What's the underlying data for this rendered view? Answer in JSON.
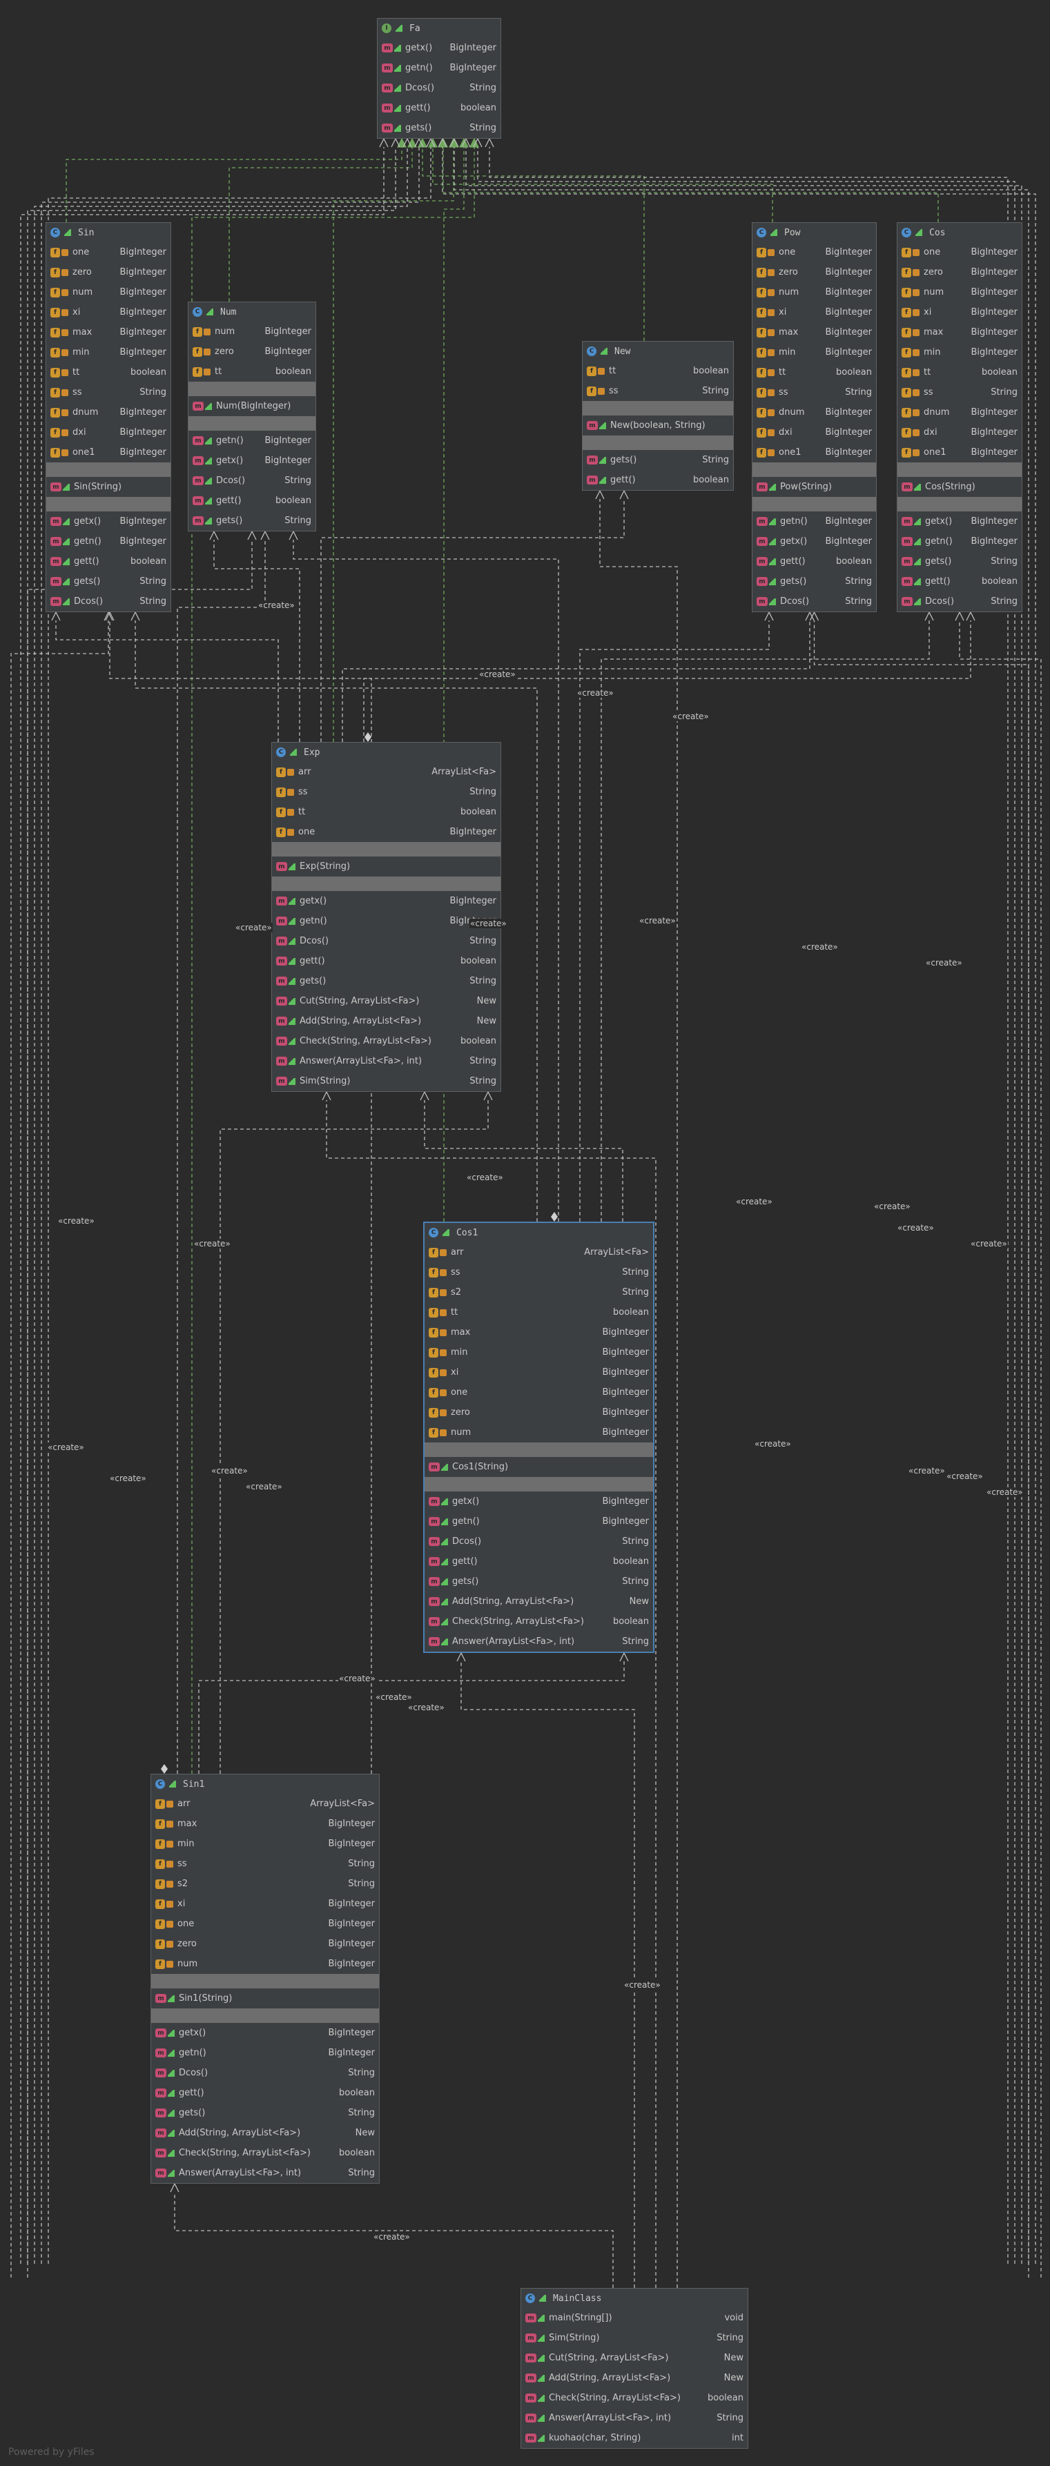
{
  "create_label": "«create»",
  "footer": "Powered by yFiles",
  "classes": {
    "fa": {
      "name": "Fa",
      "methods": [
        {
          "name": "getx()",
          "type": "BigInteger"
        },
        {
          "name": "getn()",
          "type": "BigInteger"
        },
        {
          "name": "Dcos()",
          "type": "String"
        },
        {
          "name": "gett()",
          "type": "boolean"
        },
        {
          "name": "gets()",
          "type": "String"
        }
      ]
    },
    "sin": {
      "name": "Sin",
      "fields": [
        {
          "name": "one",
          "type": "BigInteger"
        },
        {
          "name": "zero",
          "type": "BigInteger"
        },
        {
          "name": "num",
          "type": "BigInteger"
        },
        {
          "name": "xi",
          "type": "BigInteger"
        },
        {
          "name": "max",
          "type": "BigInteger"
        },
        {
          "name": "min",
          "type": "BigInteger"
        },
        {
          "name": "tt",
          "type": "boolean"
        },
        {
          "name": "ss",
          "type": "String"
        },
        {
          "name": "dnum",
          "type": "BigInteger"
        },
        {
          "name": "dxi",
          "type": "BigInteger"
        },
        {
          "name": "one1",
          "type": "BigInteger"
        }
      ],
      "constructors": [
        {
          "name": "Sin(String)",
          "type": ""
        }
      ],
      "methods": [
        {
          "name": "getx()",
          "type": "BigInteger"
        },
        {
          "name": "getn()",
          "type": "BigInteger"
        },
        {
          "name": "gett()",
          "type": "boolean"
        },
        {
          "name": "gets()",
          "type": "String"
        },
        {
          "name": "Dcos()",
          "type": "String"
        }
      ]
    },
    "num": {
      "name": "Num",
      "fields": [
        {
          "name": "num",
          "type": "BigInteger"
        },
        {
          "name": "zero",
          "type": "BigInteger"
        },
        {
          "name": "tt",
          "type": "boolean"
        }
      ],
      "constructors": [
        {
          "name": "Num(BigInteger)",
          "type": ""
        }
      ],
      "methods": [
        {
          "name": "getn()",
          "type": "BigInteger"
        },
        {
          "name": "getx()",
          "type": "BigInteger"
        },
        {
          "name": "Dcos()",
          "type": "String"
        },
        {
          "name": "gett()",
          "type": "boolean"
        },
        {
          "name": "gets()",
          "type": "String"
        }
      ]
    },
    "new": {
      "name": "New",
      "fields": [
        {
          "name": "tt",
          "type": "boolean"
        },
        {
          "name": "ss",
          "type": "String"
        }
      ],
      "constructors": [
        {
          "name": "New(boolean, String)",
          "type": ""
        }
      ],
      "methods": [
        {
          "name": "gets()",
          "type": "String"
        },
        {
          "name": "gett()",
          "type": "boolean"
        }
      ]
    },
    "pow": {
      "name": "Pow",
      "fields": [
        {
          "name": "one",
          "type": "BigInteger"
        },
        {
          "name": "zero",
          "type": "BigInteger"
        },
        {
          "name": "num",
          "type": "BigInteger"
        },
        {
          "name": "xi",
          "type": "BigInteger"
        },
        {
          "name": "max",
          "type": "BigInteger"
        },
        {
          "name": "min",
          "type": "BigInteger"
        },
        {
          "name": "tt",
          "type": "boolean"
        },
        {
          "name": "ss",
          "type": "String"
        },
        {
          "name": "dnum",
          "type": "BigInteger"
        },
        {
          "name": "dxi",
          "type": "BigInteger"
        },
        {
          "name": "one1",
          "type": "BigInteger"
        }
      ],
      "constructors": [
        {
          "name": "Pow(String)",
          "type": ""
        }
      ],
      "methods": [
        {
          "name": "getn()",
          "type": "BigInteger"
        },
        {
          "name": "getx()",
          "type": "BigInteger"
        },
        {
          "name": "gett()",
          "type": "boolean"
        },
        {
          "name": "gets()",
          "type": "String"
        },
        {
          "name": "Dcos()",
          "type": "String"
        }
      ]
    },
    "cos": {
      "name": "Cos",
      "fields": [
        {
          "name": "one",
          "type": "BigInteger"
        },
        {
          "name": "zero",
          "type": "BigInteger"
        },
        {
          "name": "num",
          "type": "BigInteger"
        },
        {
          "name": "xi",
          "type": "BigInteger"
        },
        {
          "name": "max",
          "type": "BigInteger"
        },
        {
          "name": "min",
          "type": "BigInteger"
        },
        {
          "name": "tt",
          "type": "boolean"
        },
        {
          "name": "ss",
          "type": "String"
        },
        {
          "name": "dnum",
          "type": "BigInteger"
        },
        {
          "name": "dxi",
          "type": "BigInteger"
        },
        {
          "name": "one1",
          "type": "BigInteger"
        }
      ],
      "constructors": [
        {
          "name": "Cos(String)",
          "type": ""
        }
      ],
      "methods": [
        {
          "name": "getx()",
          "type": "BigInteger"
        },
        {
          "name": "getn()",
          "type": "BigInteger"
        },
        {
          "name": "gets()",
          "type": "String"
        },
        {
          "name": "gett()",
          "type": "boolean"
        },
        {
          "name": "Dcos()",
          "type": "String"
        }
      ]
    },
    "exp": {
      "name": "Exp",
      "fields": [
        {
          "name": "arr",
          "type": "ArrayList<Fa>"
        },
        {
          "name": "ss",
          "type": "String"
        },
        {
          "name": "tt",
          "type": "boolean"
        },
        {
          "name": "one",
          "type": "BigInteger"
        }
      ],
      "constructors": [
        {
          "name": "Exp(String)",
          "type": ""
        }
      ],
      "methods": [
        {
          "name": "getx()",
          "type": "BigInteger"
        },
        {
          "name": "getn()",
          "type": "BigInteger"
        },
        {
          "name": "Dcos()",
          "type": "String"
        },
        {
          "name": "gett()",
          "type": "boolean"
        },
        {
          "name": "gets()",
          "type": "String"
        },
        {
          "name": "Cut(String, ArrayList<Fa>)",
          "type": "New"
        },
        {
          "name": "Add(String, ArrayList<Fa>)",
          "type": "New"
        },
        {
          "name": "Check(String, ArrayList<Fa>)",
          "type": "boolean"
        },
        {
          "name": "Answer(ArrayList<Fa>, int)",
          "type": "String"
        },
        {
          "name": "Sim(String)",
          "type": "String"
        }
      ]
    },
    "cos1": {
      "name": "Cos1",
      "fields": [
        {
          "name": "arr",
          "type": "ArrayList<Fa>"
        },
        {
          "name": "ss",
          "type": "String"
        },
        {
          "name": "s2",
          "type": "String"
        },
        {
          "name": "tt",
          "type": "boolean"
        },
        {
          "name": "max",
          "type": "BigInteger"
        },
        {
          "name": "min",
          "type": "BigInteger"
        },
        {
          "name": "xi",
          "type": "BigInteger"
        },
        {
          "name": "one",
          "type": "BigInteger"
        },
        {
          "name": "zero",
          "type": "BigInteger"
        },
        {
          "name": "num",
          "type": "BigInteger"
        }
      ],
      "constructors": [
        {
          "name": "Cos1(String)",
          "type": ""
        }
      ],
      "methods": [
        {
          "name": "getx()",
          "type": "BigInteger"
        },
        {
          "name": "getn()",
          "type": "BigInteger"
        },
        {
          "name": "Dcos()",
          "type": "String"
        },
        {
          "name": "gett()",
          "type": "boolean"
        },
        {
          "name": "gets()",
          "type": "String"
        },
        {
          "name": "Add(String, ArrayList<Fa>)",
          "type": "New"
        },
        {
          "name": "Check(String, ArrayList<Fa>)",
          "type": "boolean"
        },
        {
          "name": "Answer(ArrayList<Fa>, int)",
          "type": "String"
        }
      ]
    },
    "sin1": {
      "name": "Sin1",
      "fields": [
        {
          "name": "arr",
          "type": "ArrayList<Fa>"
        },
        {
          "name": "max",
          "type": "BigInteger"
        },
        {
          "name": "min",
          "type": "BigInteger"
        },
        {
          "name": "ss",
          "type": "String"
        },
        {
          "name": "s2",
          "type": "String"
        },
        {
          "name": "xi",
          "type": "BigInteger"
        },
        {
          "name": "one",
          "type": "BigInteger"
        },
        {
          "name": "zero",
          "type": "BigInteger"
        },
        {
          "name": "num",
          "type": "BigInteger"
        }
      ],
      "constructors": [
        {
          "name": "Sin1(String)",
          "type": ""
        }
      ],
      "methods": [
        {
          "name": "getx()",
          "type": "BigInteger"
        },
        {
          "name": "getn()",
          "type": "BigInteger"
        },
        {
          "name": "Dcos()",
          "type": "String"
        },
        {
          "name": "gett()",
          "type": "boolean"
        },
        {
          "name": "gets()",
          "type": "String"
        },
        {
          "name": "Add(String, ArrayList<Fa>)",
          "type": "New"
        },
        {
          "name": "Check(String, ArrayList<Fa>)",
          "type": "boolean"
        },
        {
          "name": "Answer(ArrayList<Fa>, int)",
          "type": "String"
        }
      ]
    },
    "mainclass": {
      "name": "MainClass",
      "methods": [
        {
          "name": "main(String[])",
          "type": "void"
        },
        {
          "name": "Sim(String)",
          "type": "String"
        },
        {
          "name": "Cut(String, ArrayList<Fa>)",
          "type": "New"
        },
        {
          "name": "Add(String, ArrayList<Fa>)",
          "type": "New"
        },
        {
          "name": "Check(String, ArrayList<Fa>)",
          "type": "boolean"
        },
        {
          "name": "Answer(ArrayList<Fa>, int)",
          "type": "String"
        },
        {
          "name": "kuohao(char, String)",
          "type": "int"
        }
      ]
    }
  }
}
